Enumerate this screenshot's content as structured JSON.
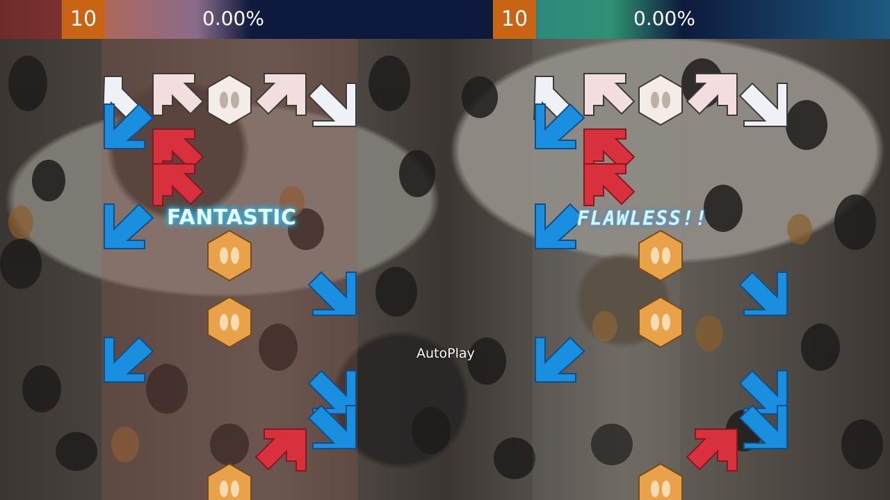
{
  "player1": {
    "level": "10",
    "percent": "0.00%",
    "judgment": "FANTASTIC"
  },
  "player2": {
    "level": "10",
    "percent": "0.00%",
    "judgment": "FLAWLESS!!"
  },
  "center_label": "AutoPlay",
  "colors": {
    "blue_arrow": "#1a8fe0",
    "red_arrow": "#d9303e",
    "orange_center": "#e7a24a",
    "receptor": "#f2e4e4"
  },
  "icons": {
    "down_left_arrow": "down-left-arrow-icon",
    "up_left_arrow": "up-left-arrow-icon",
    "center_panel": "center-panel-icon",
    "up_right_arrow": "up-right-arrow-icon",
    "down_right_arrow": "down-right-arrow-icon"
  }
}
